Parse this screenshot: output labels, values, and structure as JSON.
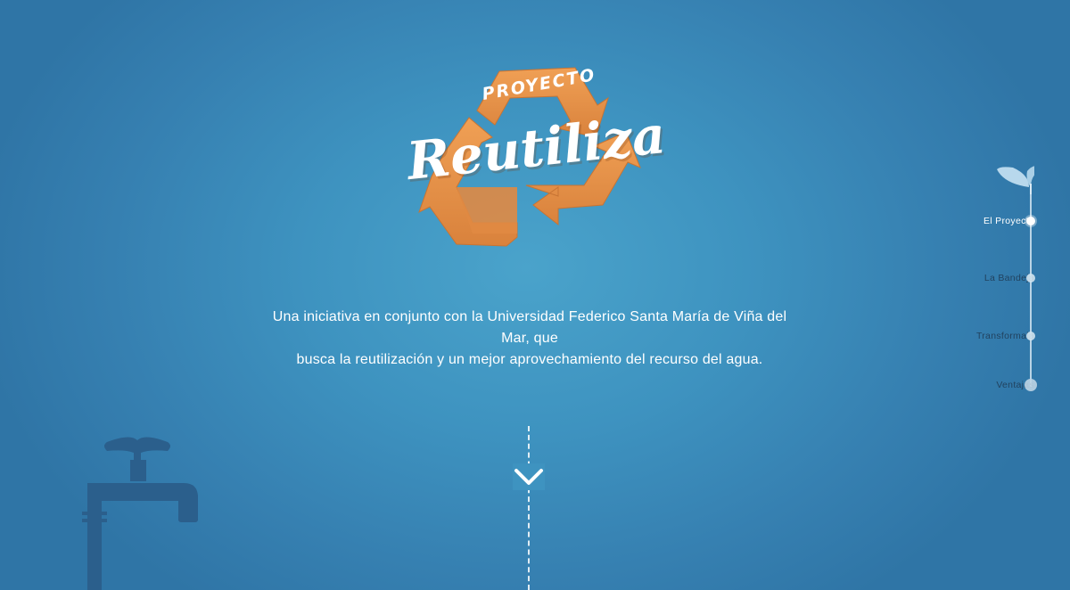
{
  "brand": {
    "small": "PROYECTO",
    "name": "Reutiliza"
  },
  "intro": {
    "line1": "Una iniciativa en conjunto con la Universidad Federico Santa María de Viña del Mar, que",
    "line2": "busca la reutilización y un mejor aprovechamiento del recurso del agua."
  },
  "nav": {
    "items": [
      {
        "label": "El Proyecto",
        "active": true
      },
      {
        "label": "La Bandeja",
        "active": false
      },
      {
        "label": "Transformala",
        "active": false
      },
      {
        "label": "Ventajas",
        "active": false
      }
    ]
  },
  "icons": {
    "logo": "recycle-icon",
    "scroll": "chevron-down-icon",
    "faucet": "faucet-icon",
    "sprout": "sprout-icon"
  },
  "colors": {
    "background": "#3e93c0",
    "accent": "#e8934a",
    "silhouette": "#2b5f8c"
  }
}
